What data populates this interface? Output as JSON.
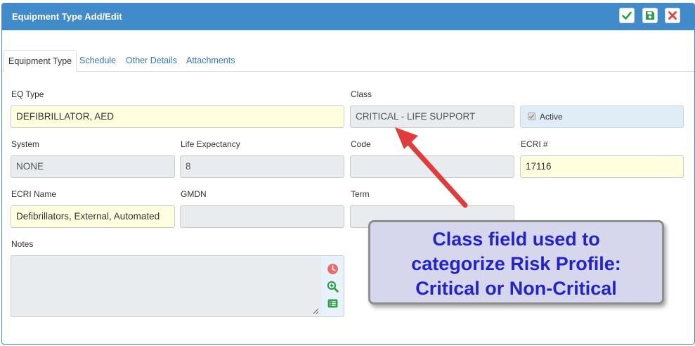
{
  "dialog": {
    "title": "Equipment Type Add/Edit",
    "icons": {
      "save_check": "check-icon",
      "save": "floppy-disk-icon",
      "close": "close-icon"
    }
  },
  "tabs": [
    {
      "label": "Equipment Type",
      "active": true
    },
    {
      "label": "Schedule",
      "active": false
    },
    {
      "label": "Other Details",
      "active": false
    },
    {
      "label": "Attachments",
      "active": false
    }
  ],
  "form": {
    "eq_type": {
      "label": "EQ Type",
      "value": "DEFIBRILLATOR, AED"
    },
    "class": {
      "label": "Class",
      "value": "CRITICAL - LIFE SUPPORT"
    },
    "active": {
      "label": "Active",
      "checked": true
    },
    "system": {
      "label": "System",
      "value": "NONE"
    },
    "life_expectancy": {
      "label": "Life Expectancy",
      "value": "8"
    },
    "code": {
      "label": "Code",
      "value": ""
    },
    "ecri_no": {
      "label": "ECRI #",
      "value": "17116"
    },
    "ecri_name": {
      "label": "ECRI Name",
      "value": "Defibrillators, External, Automated"
    },
    "gmdn": {
      "label": "GMDN",
      "value": ""
    },
    "term": {
      "label": "Term",
      "value": ""
    },
    "notes": {
      "label": "Notes",
      "value": ""
    }
  },
  "notes_tools": [
    "clock-icon",
    "zoom-in-icon",
    "list-icon"
  ],
  "annotation": {
    "lines": [
      "Class field used to",
      "categorize Risk Profile:",
      "Critical or Non-Critical"
    ]
  },
  "colors": {
    "header": "#428bca",
    "required_field": "#ffffe0",
    "readonly_field": "#e9ecef",
    "confirm": "#2e9e48",
    "cancel": "#e0443a",
    "callout_text": "#2224c8",
    "arrow": "#e23b3b"
  }
}
